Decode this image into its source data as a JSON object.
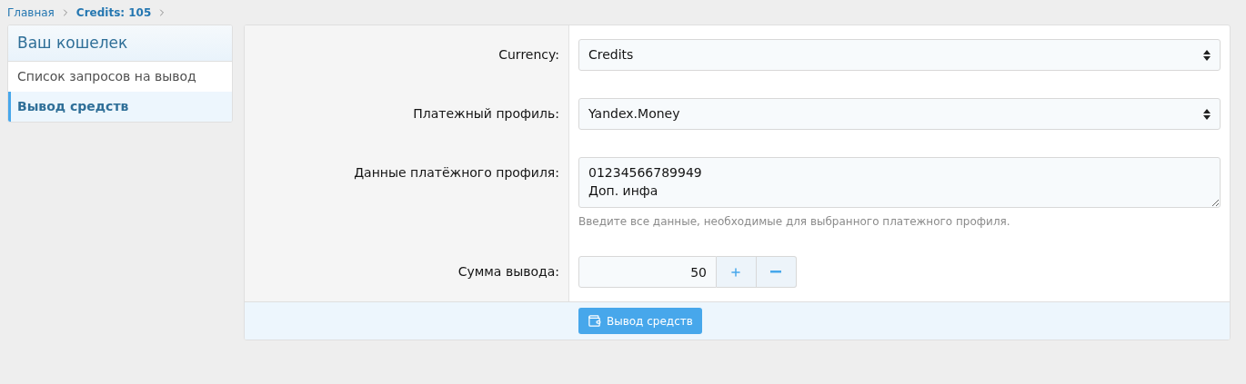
{
  "breadcrumb": [
    {
      "label": "Главная",
      "current": false
    },
    {
      "label": "Credits: 105",
      "current": true
    }
  ],
  "sidebar": {
    "title": "Ваш кошелек",
    "items": [
      {
        "label": "Список запросов на вывод",
        "selected": false
      },
      {
        "label": "Вывод средств",
        "selected": true
      }
    ]
  },
  "form": {
    "rows": [
      {
        "kind": "select",
        "label": "Currency:",
        "value": "Credits"
      },
      {
        "kind": "select",
        "label": "Платежный профиль:",
        "value": "Yandex.Money"
      },
      {
        "kind": "textarea",
        "label": "Данные платёжного профиля:",
        "value": "01234566789949\nДоп. инфа",
        "hint": "Введите все данные, необходимые для выбранного платежного профиля."
      },
      {
        "kind": "number",
        "label": "Сумма вывода:",
        "value": "50"
      }
    ],
    "submit": "Вывод средств"
  }
}
